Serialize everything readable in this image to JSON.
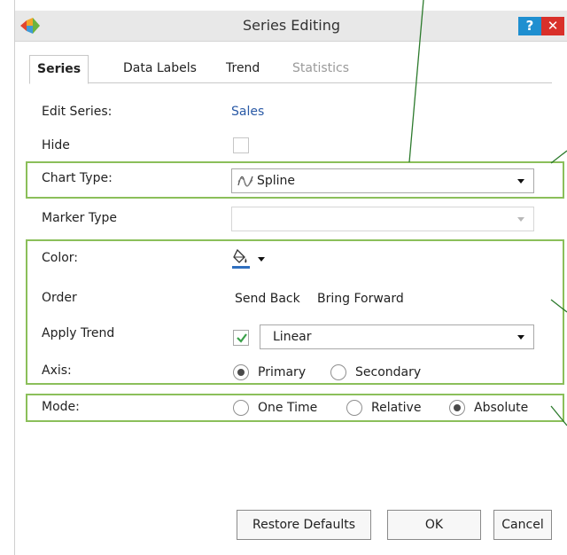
{
  "window": {
    "title": "Series Editing",
    "help_label": "?",
    "close_label": "✕"
  },
  "tabs": [
    {
      "label": "Series",
      "state": "active"
    },
    {
      "label": "Data Labels",
      "state": "normal"
    },
    {
      "label": "Trend",
      "state": "normal"
    },
    {
      "label": "Statistics",
      "state": "disabled"
    }
  ],
  "form": {
    "edit_series": {
      "label": "Edit Series:",
      "value": "Sales"
    },
    "hide": {
      "label": "Hide",
      "checked": false
    },
    "chart_type": {
      "label": "Chart Type:",
      "value": "Spline"
    },
    "marker_type": {
      "label": "Marker Type",
      "value": ""
    },
    "color": {
      "label": "Color:",
      "icon": "paint-bucket-icon"
    },
    "order": {
      "label": "Order",
      "send_back": "Send Back",
      "bring_forward": "Bring Forward"
    },
    "apply_trend": {
      "label": "Apply Trend",
      "checked": true,
      "value": "Linear"
    },
    "axis": {
      "label": "Axis:",
      "options": [
        {
          "label": "Primary",
          "selected": true
        },
        {
          "label": "Secondary",
          "selected": false
        }
      ]
    },
    "mode": {
      "label": "Mode:",
      "options": [
        {
          "label": "One Time",
          "selected": false
        },
        {
          "label": "Relative",
          "selected": false
        },
        {
          "label": "Absolute",
          "selected": true
        }
      ]
    }
  },
  "buttons": {
    "restore": "Restore Defaults",
    "ok": "OK",
    "cancel": "Cancel"
  },
  "colors": {
    "highlight": "#8bbf5a",
    "close": "#d9302a",
    "help": "#1f8fd0",
    "link": "#2a5aa6"
  }
}
